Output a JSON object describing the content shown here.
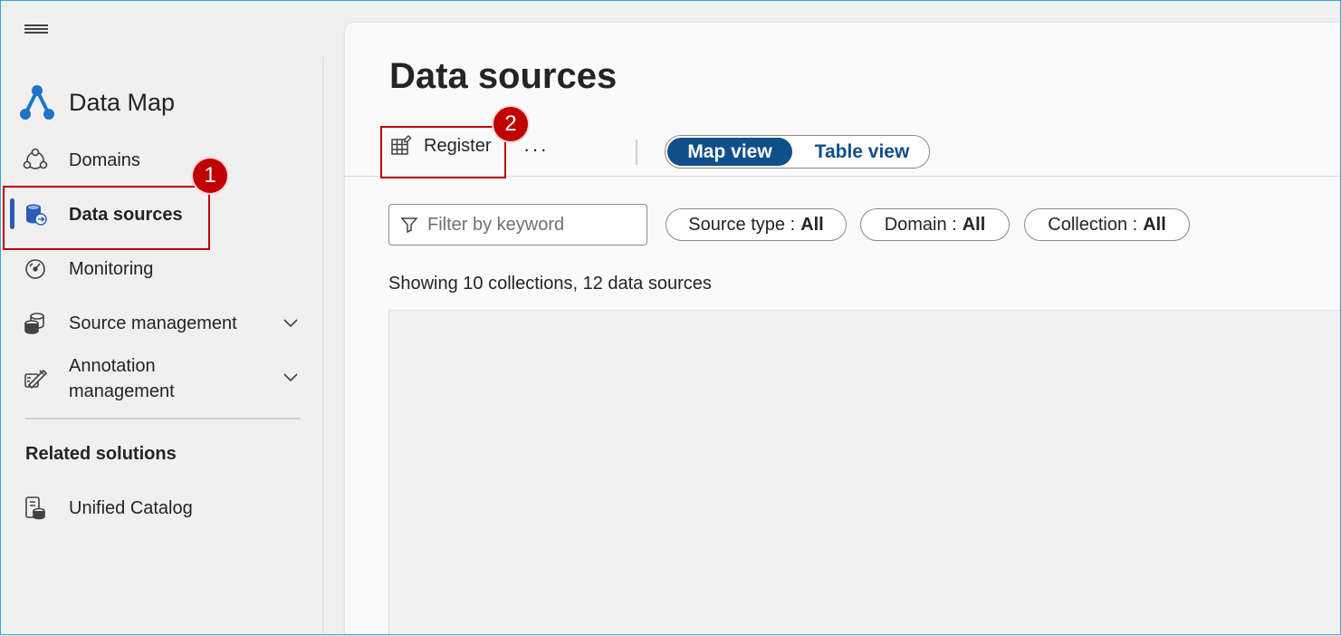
{
  "brand": {
    "name": "Data Map"
  },
  "sidebar": {
    "items": [
      {
        "label": "Domains",
        "icon": "domains-icon"
      },
      {
        "label": "Data sources",
        "icon": "data-sources-icon",
        "active": true
      },
      {
        "label": "Monitoring",
        "icon": "monitoring-icon"
      },
      {
        "label": "Source management",
        "icon": "source-management-icon",
        "expandable": true
      },
      {
        "label": "Annotation management",
        "icon": "annotation-management-icon",
        "expandable": true
      }
    ],
    "related_heading": "Related solutions",
    "related_items": [
      {
        "label": "Unified Catalog",
        "icon": "unified-catalog-icon"
      }
    ]
  },
  "main": {
    "title": "Data sources",
    "toolbar": {
      "register_label": "Register",
      "more_label": "···"
    },
    "view_toggle": {
      "map": "Map view",
      "table": "Table view",
      "selected": "Map view"
    },
    "filter": {
      "placeholder": "Filter by keyword",
      "pills": [
        {
          "label": "Source type : ",
          "value": "All"
        },
        {
          "label": "Domain : ",
          "value": "All"
        },
        {
          "label": "Collection : ",
          "value": "All"
        }
      ]
    },
    "summary": "Showing 10 collections, 12 data sources"
  },
  "callouts": [
    {
      "number": "1",
      "target": "Data sources"
    },
    {
      "number": "2",
      "target": "Register"
    }
  ],
  "colors": {
    "accent": "#0f4f8a",
    "active_indicator": "#2b5db3",
    "callout": "#c00000",
    "brand_icon": "#1e74c6"
  }
}
